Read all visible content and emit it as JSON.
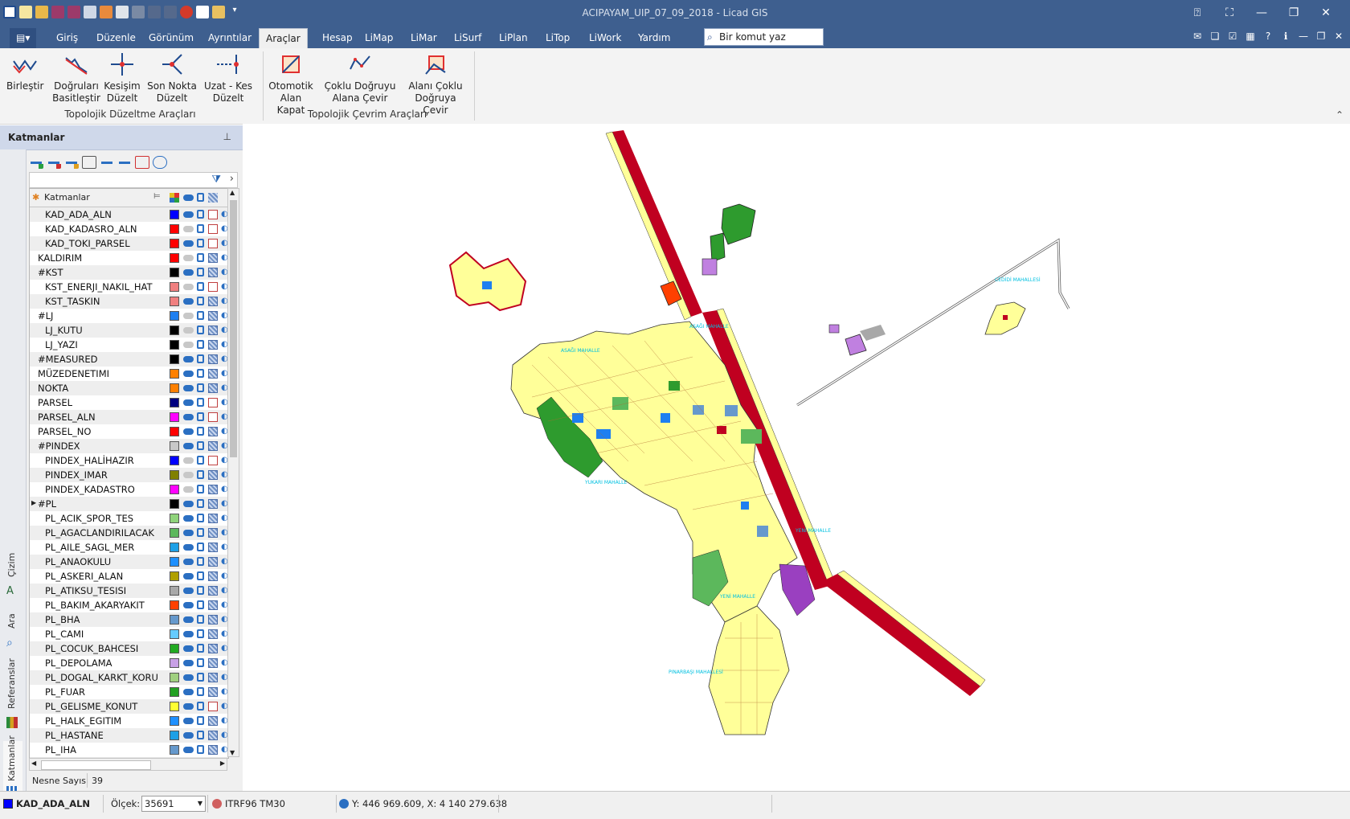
{
  "window": {
    "title": "ACIPAYAM_UIP_07_09_2018 - Licad GIS"
  },
  "menu": {
    "tabs": [
      "Giriş",
      "Düzenle",
      "Görünüm",
      "Ayrıntılar",
      "Araçlar",
      "Hesap",
      "LiMap",
      "LiMar",
      "LiSurf",
      "LiPlan",
      "LiTop",
      "LiWork",
      "Yardım"
    ],
    "active": "Araçlar",
    "command_placeholder": "Bir komut yaz"
  },
  "ribbon": {
    "buttons": [
      {
        "label1": "Birleştir",
        "label2": ""
      },
      {
        "label1": "Doğruları",
        "label2": "Basitleştir"
      },
      {
        "label1": "Kesişim",
        "label2": "Düzelt"
      },
      {
        "label1": "Son Nokta",
        "label2": "Düzelt"
      },
      {
        "label1": "Uzat - Kes",
        "label2": "Düzelt"
      },
      {
        "label1": "Otomotik",
        "label2": "Alan Kapat"
      },
      {
        "label1": "Çoklu Doğruyu",
        "label2": "Alana Çevir"
      },
      {
        "label1": "Alanı Çoklu",
        "label2": "Doğruya Çevir"
      }
    ],
    "groups": [
      "Topolojik Düzeltme Araçları",
      "Topolojik Çevrim Araçları"
    ]
  },
  "panel": {
    "title": "Katmanlar",
    "column_header": "Katmanlar",
    "side_tabs": [
      "Çizim",
      "Ara",
      "Referanslar",
      "Katmanlar"
    ],
    "object_count_label": "Nesne Sayısı",
    "object_count": "39"
  },
  "layers": [
    {
      "name": "KAD_ADA_ALN",
      "indent": 1,
      "color": "#0000ff",
      "visible": true,
      "fill": "empty"
    },
    {
      "name": "KAD_KADASRO_ALN",
      "indent": 1,
      "color": "#ff0000",
      "visible": false,
      "fill": "empty"
    },
    {
      "name": "KAD_TOKI_PARSEL",
      "indent": 1,
      "color": "#ff0000",
      "visible": true,
      "fill": "empty"
    },
    {
      "name": "KALDIRIM",
      "indent": 0,
      "color": "#ff0000",
      "visible": false,
      "fill": "hatch"
    },
    {
      "name": "#KST",
      "indent": 0,
      "color": "#000000",
      "visible": true,
      "fill": "hatch"
    },
    {
      "name": "KST_ENERJI_NAKIL_HAT",
      "indent": 1,
      "color": "#f08080",
      "visible": false,
      "fill": "empty"
    },
    {
      "name": "KST_TASKIN",
      "indent": 1,
      "color": "#f08080",
      "visible": true,
      "fill": "hatch"
    },
    {
      "name": "#LJ",
      "indent": 0,
      "color": "#1e7ff0",
      "visible": false,
      "fill": "hatch"
    },
    {
      "name": "LJ_KUTU",
      "indent": 1,
      "color": "#000000",
      "visible": false,
      "fill": "hatch"
    },
    {
      "name": "LJ_YAZI",
      "indent": 1,
      "color": "#000000",
      "visible": false,
      "fill": "hatch"
    },
    {
      "name": "#MEASURED",
      "indent": 0,
      "color": "#000000",
      "visible": true,
      "fill": "hatch"
    },
    {
      "name": "MÜZEDENETIMI",
      "indent": 0,
      "color": "#ff8000",
      "visible": true,
      "fill": "hatch"
    },
    {
      "name": "NOKTA",
      "indent": 0,
      "color": "#ff8000",
      "visible": true,
      "fill": "hatch"
    },
    {
      "name": "PARSEL",
      "indent": 0,
      "color": "#000080",
      "visible": true,
      "fill": "empty"
    },
    {
      "name": "PARSEL_ALN",
      "indent": 0,
      "color": "#ff00ff",
      "visible": true,
      "fill": "empty"
    },
    {
      "name": "PARSEL_NO",
      "indent": 0,
      "color": "#ff0000",
      "visible": true,
      "fill": "hatch"
    },
    {
      "name": "#PINDEX",
      "indent": 0,
      "color": "#c8c8c8",
      "visible": true,
      "fill": "hatch"
    },
    {
      "name": "PINDEX_HALİHAZIR",
      "indent": 1,
      "color": "#0000ff",
      "visible": false,
      "fill": "empty"
    },
    {
      "name": "PINDEX_IMAR",
      "indent": 1,
      "color": "#808000",
      "visible": false,
      "fill": "hatch"
    },
    {
      "name": "PINDEX_KADASTRO",
      "indent": 1,
      "color": "#ff00ff",
      "visible": false,
      "fill": "hatch"
    },
    {
      "name": "#PL",
      "indent": 0,
      "color": "#000000",
      "visible": true,
      "fill": "hatch",
      "expander": true
    },
    {
      "name": "PL_ACIK_SPOR_TES",
      "indent": 1,
      "color": "#8fd37a",
      "visible": true,
      "fill": "hatch"
    },
    {
      "name": "PL_AGACLANDIRILACAK",
      "indent": 1,
      "color": "#5cb85c",
      "visible": true,
      "fill": "hatch"
    },
    {
      "name": "PL_AILE_SAGL_MER",
      "indent": 1,
      "color": "#1ea0e6",
      "visible": true,
      "fill": "hatch"
    },
    {
      "name": "PL_ANAOKULU",
      "indent": 1,
      "color": "#1e90ff",
      "visible": true,
      "fill": "hatch"
    },
    {
      "name": "PL_ASKERI_ALAN",
      "indent": 1,
      "color": "#b0a000",
      "visible": true,
      "fill": "hatch"
    },
    {
      "name": "PL_ATIKSU_TESISI",
      "indent": 1,
      "color": "#a8a8a8",
      "visible": true,
      "fill": "hatch"
    },
    {
      "name": "PL_BAKIM_AKARYAKIT",
      "indent": 1,
      "color": "#ff4000",
      "visible": true,
      "fill": "hatch"
    },
    {
      "name": "PL_BHA",
      "indent": 1,
      "color": "#6699cc",
      "visible": true,
      "fill": "hatch"
    },
    {
      "name": "PL_CAMI",
      "indent": 1,
      "color": "#66ccff",
      "visible": true,
      "fill": "hatch"
    },
    {
      "name": "PL_COCUK_BAHCESI",
      "indent": 1,
      "color": "#22aa22",
      "visible": true,
      "fill": "hatch"
    },
    {
      "name": "PL_DEPOLAMA",
      "indent": 1,
      "color": "#c8a0e6",
      "visible": true,
      "fill": "hatch"
    },
    {
      "name": "PL_DOGAL_KARKT_KORU",
      "indent": 1,
      "color": "#a0d080",
      "visible": true,
      "fill": "hatch"
    },
    {
      "name": "PL_FUAR",
      "indent": 1,
      "color": "#22a022",
      "visible": true,
      "fill": "hatch"
    },
    {
      "name": "PL_GELISME_KONUT",
      "indent": 1,
      "color": "#ffff33",
      "visible": true,
      "fill": "empty"
    },
    {
      "name": "PL_HALK_EGITIM",
      "indent": 1,
      "color": "#1e90ff",
      "visible": true,
      "fill": "hatch"
    },
    {
      "name": "PL_HASTANE",
      "indent": 1,
      "color": "#1ea0e6",
      "visible": true,
      "fill": "hatch"
    },
    {
      "name": "PL_IHA",
      "indent": 1,
      "color": "#6699cc",
      "visible": true,
      "fill": "hatch"
    }
  ],
  "map": {
    "labels": [
      "ASAĞI MAHALLE",
      "CEDİDİ MAHALLESİ",
      "YUKARI MAHALLE",
      "YENİ MAHALLE",
      "YENİ MAHALLE",
      "PINARBAŞI MAHALLESİ",
      "ASAĞI MAHALLE"
    ]
  },
  "status": {
    "active_layer": "KAD_ADA_ALN",
    "scale_label": "Ölçek:",
    "scale_value": "35691",
    "crs": "ITRF96 TM30",
    "coords": "Y: 446 969.609, X: 4 140 279.638"
  },
  "colors": {
    "titlebar": "#3e5f8f",
    "road": "#c00020",
    "urban": "#ffff99",
    "green": "#2e9b2e"
  }
}
